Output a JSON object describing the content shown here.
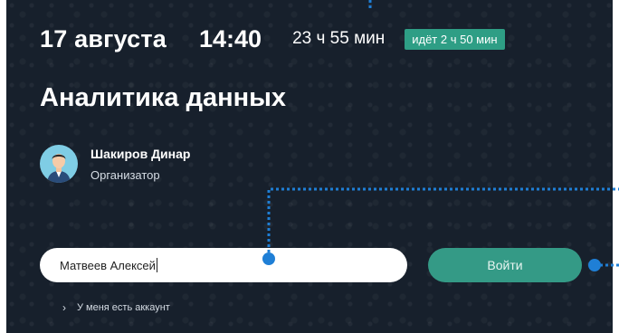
{
  "event": {
    "date": "17 августа",
    "time": "14:40",
    "duration": "23 ч 55 мин",
    "status_badge": "идёт 2 ч 50 мин",
    "title": "Аналитика данных"
  },
  "organizer": {
    "name": "Шакиров Динар",
    "role": "Организатор"
  },
  "form": {
    "name_value": "Матвеев Алексей",
    "login_label": "Войти",
    "account_link": "У меня есть аккаунт"
  },
  "colors": {
    "background": "#17202c",
    "accent": "#349a86",
    "badge": "#2e9e85",
    "guide": "#1f7fd6"
  },
  "icons": {
    "avatar": "person-avatar-icon",
    "account_chevron": "chevron-right-icon"
  }
}
